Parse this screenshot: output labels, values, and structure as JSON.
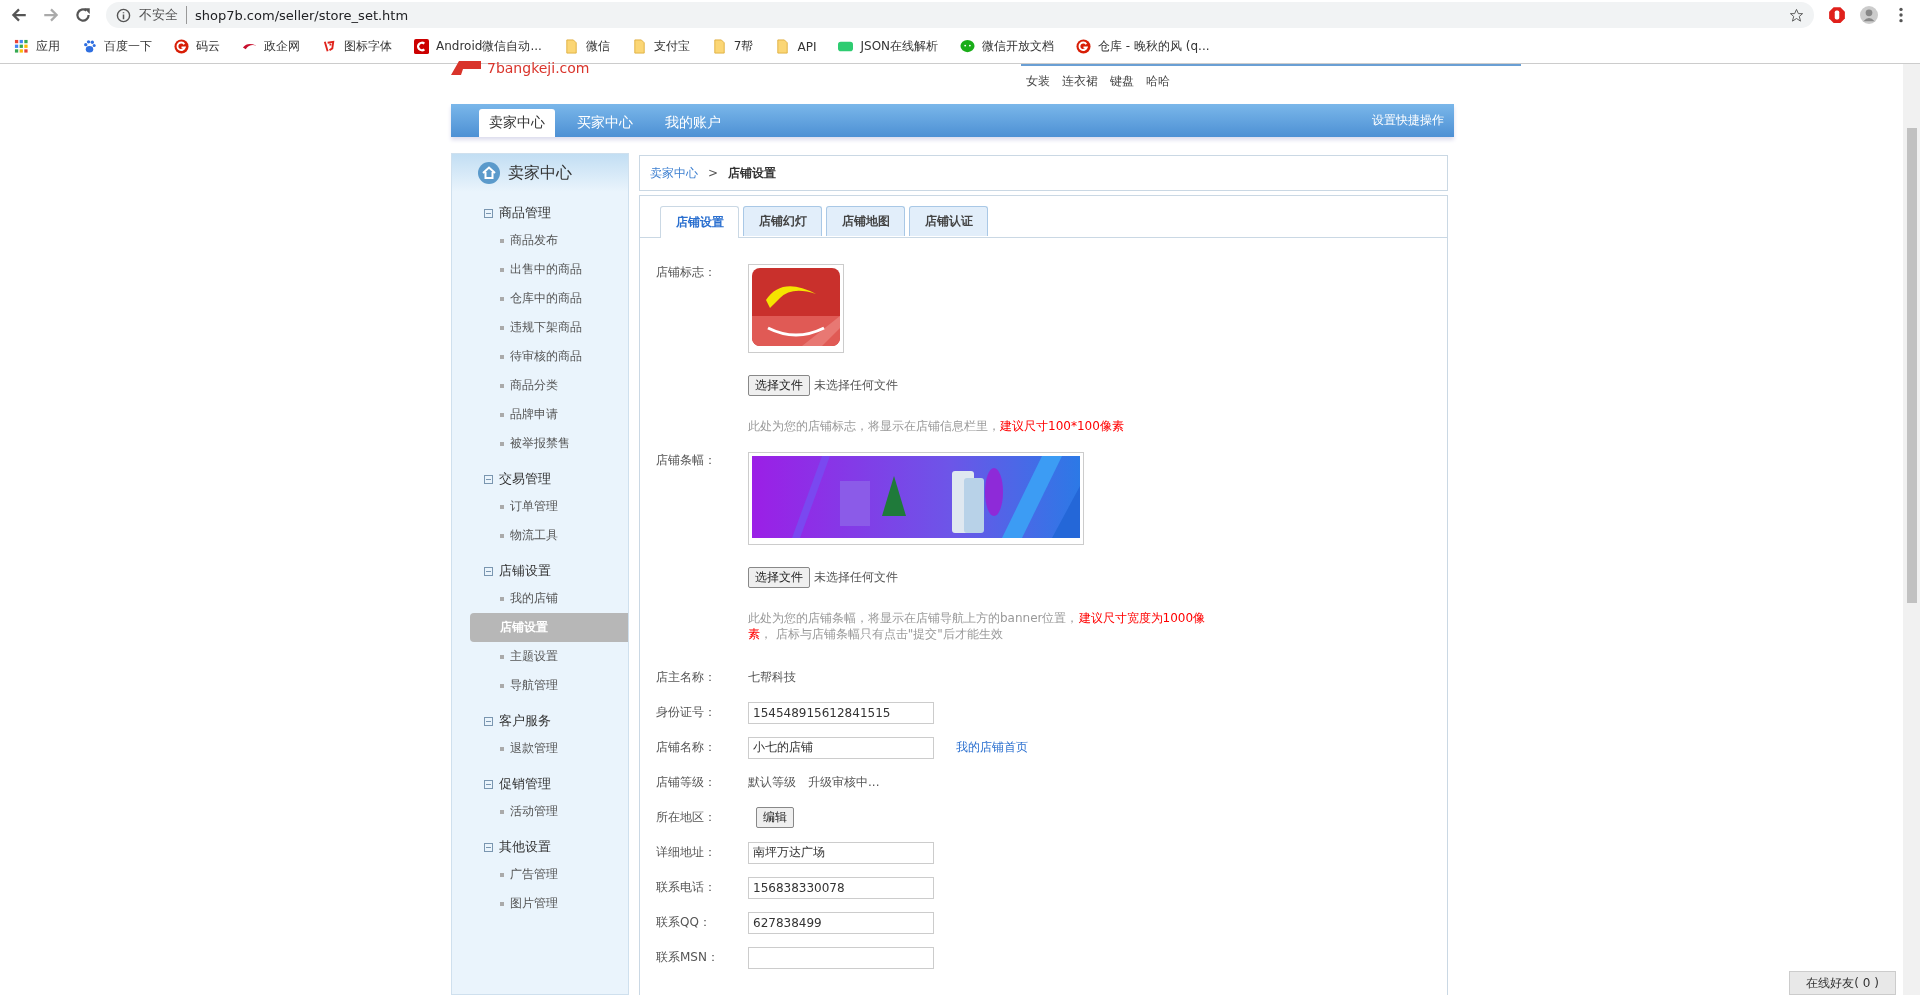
{
  "browser": {
    "security": "不安全",
    "url": "shop7b.com/seller/store_set.htm",
    "bookmarks": [
      {
        "kind": "apps",
        "label": "应用"
      },
      {
        "kind": "paw",
        "label": "百度一下"
      },
      {
        "kind": "g",
        "label": "码云"
      },
      {
        "kind": "swoosh",
        "label": "政企网"
      },
      {
        "kind": "glyph",
        "label": "图标字体"
      },
      {
        "kind": "c",
        "label": "Android微信自动..."
      },
      {
        "kind": "folder",
        "label": "微信"
      },
      {
        "kind": "folder",
        "label": "支付宝"
      },
      {
        "kind": "folder",
        "label": "7帮"
      },
      {
        "kind": "folder",
        "label": "API"
      },
      {
        "kind": "json",
        "label": "JSON在线解析"
      },
      {
        "kind": "chat",
        "label": "微信开放文档"
      },
      {
        "kind": "g",
        "label": "仓库 - 晚秋的风 (q..."
      }
    ]
  },
  "header": {
    "logo_text": "7bangkeji.com",
    "links": [
      "女装",
      "连衣裙",
      "键盘",
      "哈哈"
    ]
  },
  "nav": {
    "tabs": [
      {
        "label": "卖家中心",
        "selected": true
      },
      {
        "label": "买家中心",
        "selected": false
      },
      {
        "label": "我的账户",
        "selected": false
      }
    ],
    "shortcut": "设置快捷操作"
  },
  "sidebar": {
    "title": "卖家中心",
    "groups": [
      {
        "label": "商品管理",
        "items": [
          {
            "label": "商品发布",
            "selected": false
          },
          {
            "label": "出售中的商品",
            "selected": false
          },
          {
            "label": "仓库中的商品",
            "selected": false
          },
          {
            "label": "违规下架商品",
            "selected": false
          },
          {
            "label": "待审核的商品",
            "selected": false
          },
          {
            "label": "商品分类",
            "selected": false
          },
          {
            "label": "品牌申请",
            "selected": false
          },
          {
            "label": "被举报禁售",
            "selected": false
          }
        ]
      },
      {
        "label": "交易管理",
        "items": [
          {
            "label": "订单管理",
            "selected": false
          },
          {
            "label": "物流工具",
            "selected": false
          }
        ]
      },
      {
        "label": "店铺设置",
        "items": [
          {
            "label": "我的店铺",
            "selected": false
          },
          {
            "label": "店铺设置",
            "selected": true
          },
          {
            "label": "主题设置",
            "selected": false
          },
          {
            "label": "导航管理",
            "selected": false
          }
        ]
      },
      {
        "label": "客户服务",
        "items": [
          {
            "label": "退款管理",
            "selected": false
          }
        ]
      },
      {
        "label": "促销管理",
        "items": [
          {
            "label": "活动管理",
            "selected": false
          }
        ]
      },
      {
        "label": "其他设置",
        "items": [
          {
            "label": "广告管理",
            "selected": false
          },
          {
            "label": "图片管理",
            "selected": false
          }
        ]
      }
    ]
  },
  "breadcrumb": {
    "parent": "卖家中心",
    "separator": ">",
    "current": "店铺设置"
  },
  "tabs": [
    {
      "label": "店铺设置",
      "selected": true
    },
    {
      "label": "店铺幻灯",
      "selected": false
    },
    {
      "label": "店铺地图",
      "selected": false
    },
    {
      "label": "店铺认证",
      "selected": false
    }
  ],
  "form": [
    {
      "kind": "logo",
      "label": "店铺标志：",
      "button": "选择文件",
      "file_status": "未选择任何文件",
      "hint": "此处为您的店铺标志，将显示在店铺信息栏里，",
      "warning": "建议尺寸100*100像素"
    },
    {
      "kind": "banner",
      "label": "店铺条幅：",
      "button": "选择文件",
      "file_status": "未选择任何文件",
      "hint": "此处为您的店铺条幅，将显示在店铺导航上方的banner位置，",
      "warning": "建议尺寸宽度为1000像素",
      "hint_after": "， 店标与店铺条幅只有点击\"提交\"后才能生效"
    },
    {
      "kind": "text",
      "label": "店主名称：",
      "value": "七帮科技"
    },
    {
      "kind": "input",
      "label": "身份证号：",
      "value": "154548915612841515"
    },
    {
      "kind": "input",
      "label": "店铺名称：",
      "value": "小七的店铺",
      "link": "我的店铺首页"
    },
    {
      "kind": "texts",
      "label": "店铺等级：",
      "values": [
        "默认等级",
        "升级审核中..."
      ]
    },
    {
      "kind": "button",
      "label": "所在地区：",
      "button": "编辑"
    },
    {
      "kind": "input",
      "label": "详细地址：",
      "value": "南坪万达广场"
    },
    {
      "kind": "input",
      "label": "联系电话：",
      "value": "156838330078"
    },
    {
      "kind": "input",
      "label": "联系QQ：",
      "value": "627838499"
    },
    {
      "kind": "input",
      "label": "联系MSN："
    }
  ],
  "chat": "在线好友( 0 )"
}
